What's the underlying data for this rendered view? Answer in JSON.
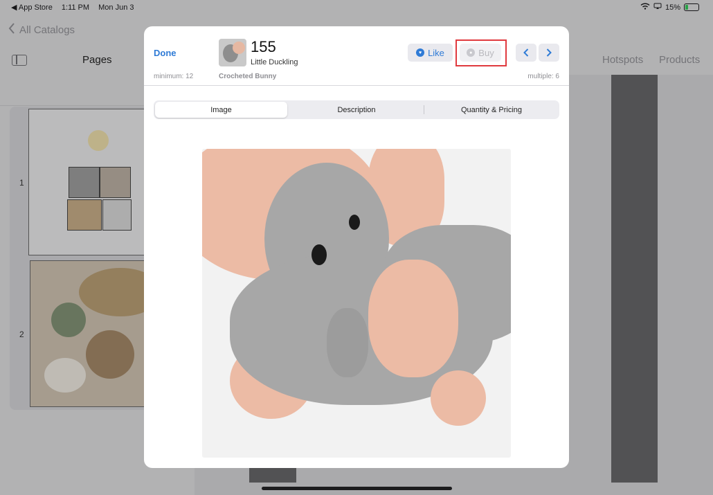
{
  "status_bar": {
    "back_app": "◀ App Store",
    "time": "1:11 PM",
    "date": "Mon Jun 3",
    "battery": "15%"
  },
  "background": {
    "back_label": "All Catalogs",
    "pages_title": "Pages",
    "tabs": [
      "Hotspots",
      "Products"
    ],
    "page_numbers": [
      "1",
      "2"
    ]
  },
  "modal": {
    "done_label": "Done",
    "product_number": "155",
    "product_subtitle": "Little Duckling",
    "product_name": "Crocheted Bunny",
    "minimum": "minimum: 12",
    "multiple": "multiple: 6",
    "like_label": "Like",
    "buy_label": "Buy",
    "segments": [
      "Image",
      "Description",
      "Quantity & Pricing"
    ],
    "selected_segment": "Image"
  },
  "colors": {
    "accent": "#2f7bd6",
    "highlight": "#e0393e",
    "disabled": "#b9b9be"
  },
  "icons": {
    "like": "heart-circle-icon",
    "buy": "cart-circle-icon",
    "prev": "chevron-left-icon",
    "next": "chevron-right-icon",
    "back": "chevron-left-icon",
    "sidebar": "sidebar-icon",
    "wifi": "wifi-icon",
    "battery": "battery-icon"
  }
}
